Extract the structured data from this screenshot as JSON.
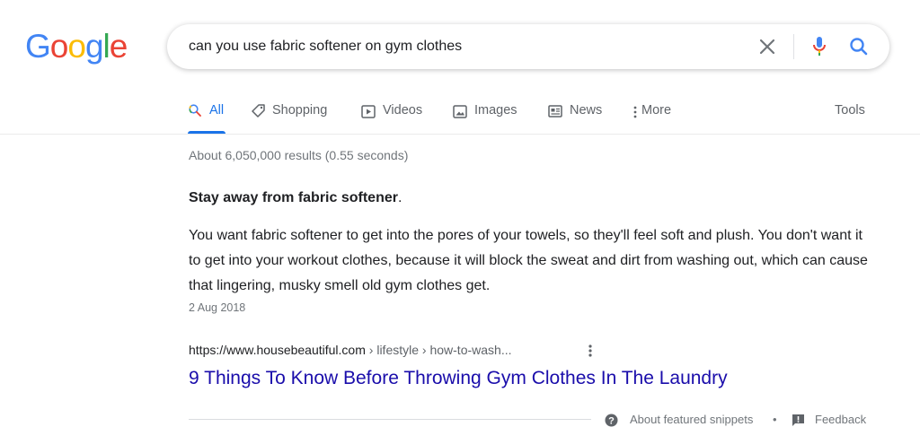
{
  "logo": {
    "letters": [
      "G",
      "o",
      "o",
      "g",
      "l",
      "e"
    ],
    "colors": [
      "#4285F4",
      "#EA4335",
      "#FBBC05",
      "#4285F4",
      "#34A853",
      "#EA4335"
    ]
  },
  "search": {
    "query": "can you use fabric softener on gym clothes"
  },
  "tabs": [
    {
      "label": "All",
      "icon": "search-icon",
      "active": true
    },
    {
      "label": "Shopping",
      "icon": "tag-icon"
    },
    {
      "label": "Videos",
      "icon": "play-icon"
    },
    {
      "label": "Images",
      "icon": "image-icon"
    },
    {
      "label": "News",
      "icon": "newspaper-icon"
    },
    {
      "label": "More",
      "icon": "more-vert-icon"
    }
  ],
  "tools_label": "Tools",
  "result_stats": "About 6,050,000 results (0.55 seconds)",
  "featured_snippet": {
    "heading_bold": "Stay away from fabric softener",
    "heading_rest": ".",
    "body": "You want fabric softener to get into the pores of your towels, so they'll feel soft and plush. You don't want it to get into your workout clothes, because it will block the sweat and dirt from washing out, which can cause that lingering, musky smell old gym clothes get.",
    "date": "2 Aug 2018",
    "cite_domain": "https://www.housebeautiful.com",
    "cite_path": " › lifestyle › how-to-wash...",
    "title": "9 Things To Know Before Throwing Gym Clothes In The Laundry"
  },
  "footer": {
    "about_label": "About featured snippets",
    "separator": "•",
    "feedback_label": "Feedback"
  },
  "colors": {
    "link": "#1a0dab",
    "accent": "#1a73e8",
    "muted": "#70757a"
  }
}
